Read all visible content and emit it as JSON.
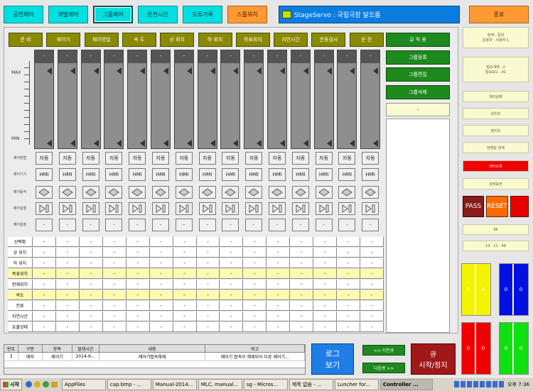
{
  "top_menu": [
    "공연제어",
    "개별제어",
    "그룹제어",
    "운전시간",
    "오류기록",
    "스톱워치"
  ],
  "title": "StageServo : 국립극장 달오름",
  "exit_label": "종료",
  "col_headers": [
    "준 비",
    "제어기",
    "제어방법",
    "속 도",
    "상 위치",
    "하 위치",
    "목표위치",
    "지연시간",
    "연동검사",
    "운 전"
  ],
  "group": {
    "selector": "큐 적 용",
    "register": "그룹등록",
    "edit": "그룹편집",
    "delete": "그룹삭제",
    "selected": "-"
  },
  "axis": {
    "max": "MAX",
    "min": "MIN"
  },
  "fader_cap": "-",
  "row_labels": [
    "제어방법",
    "제어기기",
    "제어동작",
    "제어실행",
    "제어설정"
  ],
  "btn_auto": "자동",
  "btn_hmi": "HMI",
  "btn_dash": "-",
  "grid": {
    "rows": [
      {
        "label": "선택확",
        "hl": false
      },
      {
        "label": "상 위치",
        "hl": false
      },
      {
        "label": "하 위치",
        "hl": false
      },
      {
        "label": "목표위치",
        "hl": true
      },
      {
        "label": "현재위치",
        "hl": false
      },
      {
        "label": "속도",
        "hl": true
      },
      {
        "label": "전류",
        "hl": false
      },
      {
        "label": "지연시간",
        "hl": false
      },
      {
        "label": "호출상태",
        "hl": false
      }
    ],
    "cell": "-"
  },
  "right_panels": [
    "현재 : 준비\n운용자 : 사용자 1",
    "접속개체 : 2\n접속모드 : 01",
    "체크상태",
    "원위치",
    "정지조",
    "현재값 현재",
    "제어오류",
    "상태표전"
  ],
  "pass": "PASS",
  "reset": "RESET",
  "info1": "96",
  "info2": "13 : 11 : 48",
  "quad_yellow": [
    "0",
    "0"
  ],
  "quad_blue": [
    "0",
    "0"
  ],
  "quad_red": [
    "0",
    "0"
  ],
  "quad_green": [
    "0",
    "0"
  ],
  "log": {
    "headers": [
      "번호",
      "구분",
      "항목",
      "발생시간",
      "내용",
      "비고"
    ],
    "row": [
      "3",
      "에러",
      "제어기",
      "2014-9-..",
      "제어기접속해제",
      "제어기 접속이 해제되어 다른 제어기..."
    ]
  },
  "log_btn": "로그\n보기",
  "prev_btn": "<< 이전큐",
  "next_btn": "다음큐 >>",
  "cue_btn": "큐\n시작/정지",
  "taskbar": {
    "start": "시작",
    "items": [
      "AppFiles",
      "cap.bmp - ...",
      "Manual-2014...",
      "MLC, manual...",
      "sg - Micros...",
      "제목 없음 - ...",
      "Luncher for...",
      "Controller ..."
    ],
    "clock": "오후 7:36"
  }
}
